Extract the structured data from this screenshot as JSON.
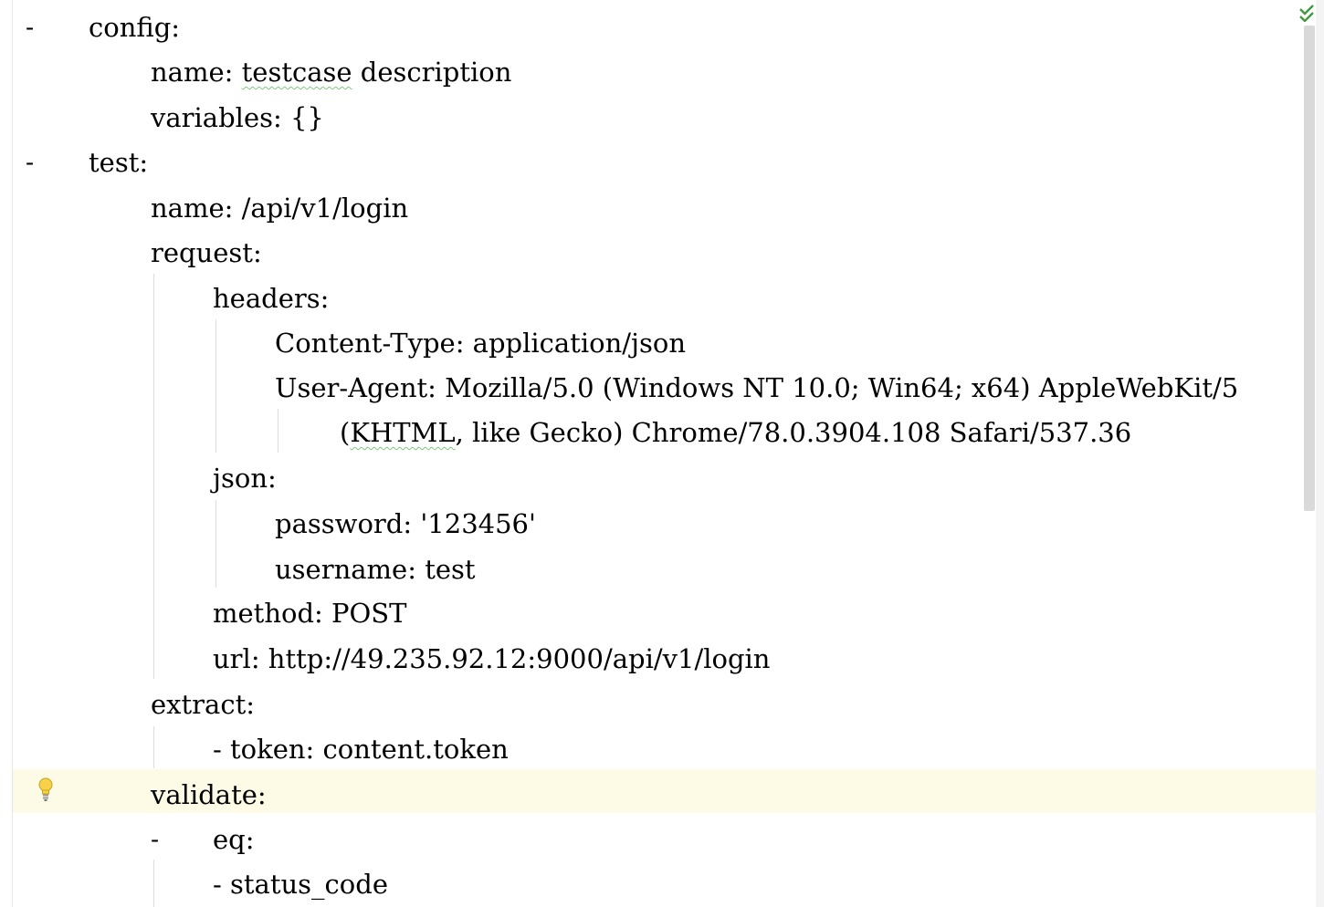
{
  "editor": {
    "lines": [
      {
        "text": "config:"
      },
      {
        "text": "name: ",
        "squiggle": "testcase",
        "rest": " description"
      },
      {
        "text": "variables: {}"
      },
      {
        "text": "test:"
      },
      {
        "text": "name: /api/v1/login"
      },
      {
        "text": "request:"
      },
      {
        "text": "headers:"
      },
      {
        "text": "Content-Type: application/json"
      },
      {
        "text": "User-Agent: Mozilla/5.0 (Windows NT 10.0; Win64; x64) AppleWebKit/5"
      },
      {
        "text": "(",
        "squiggle": "KHTML",
        "rest": ", like Gecko) Chrome/78.0.3904.108 Safari/537.36"
      },
      {
        "text": "json:"
      },
      {
        "text": "password: '123456'"
      },
      {
        "text": "username: test"
      },
      {
        "text": "method: POST"
      },
      {
        "text": "url: http://49.235.92.12:9000/api/v1/login"
      },
      {
        "text": "extract:"
      },
      {
        "text": "- token: content.token"
      },
      {
        "text": "validate:"
      },
      {
        "text": "eq:"
      },
      {
        "text": "- status_code"
      }
    ],
    "fold_markers": [
      "-",
      "-",
      "-"
    ],
    "icons": {
      "inspection_ok": "check-icon",
      "intention_bulb": "lightbulb-icon"
    }
  }
}
